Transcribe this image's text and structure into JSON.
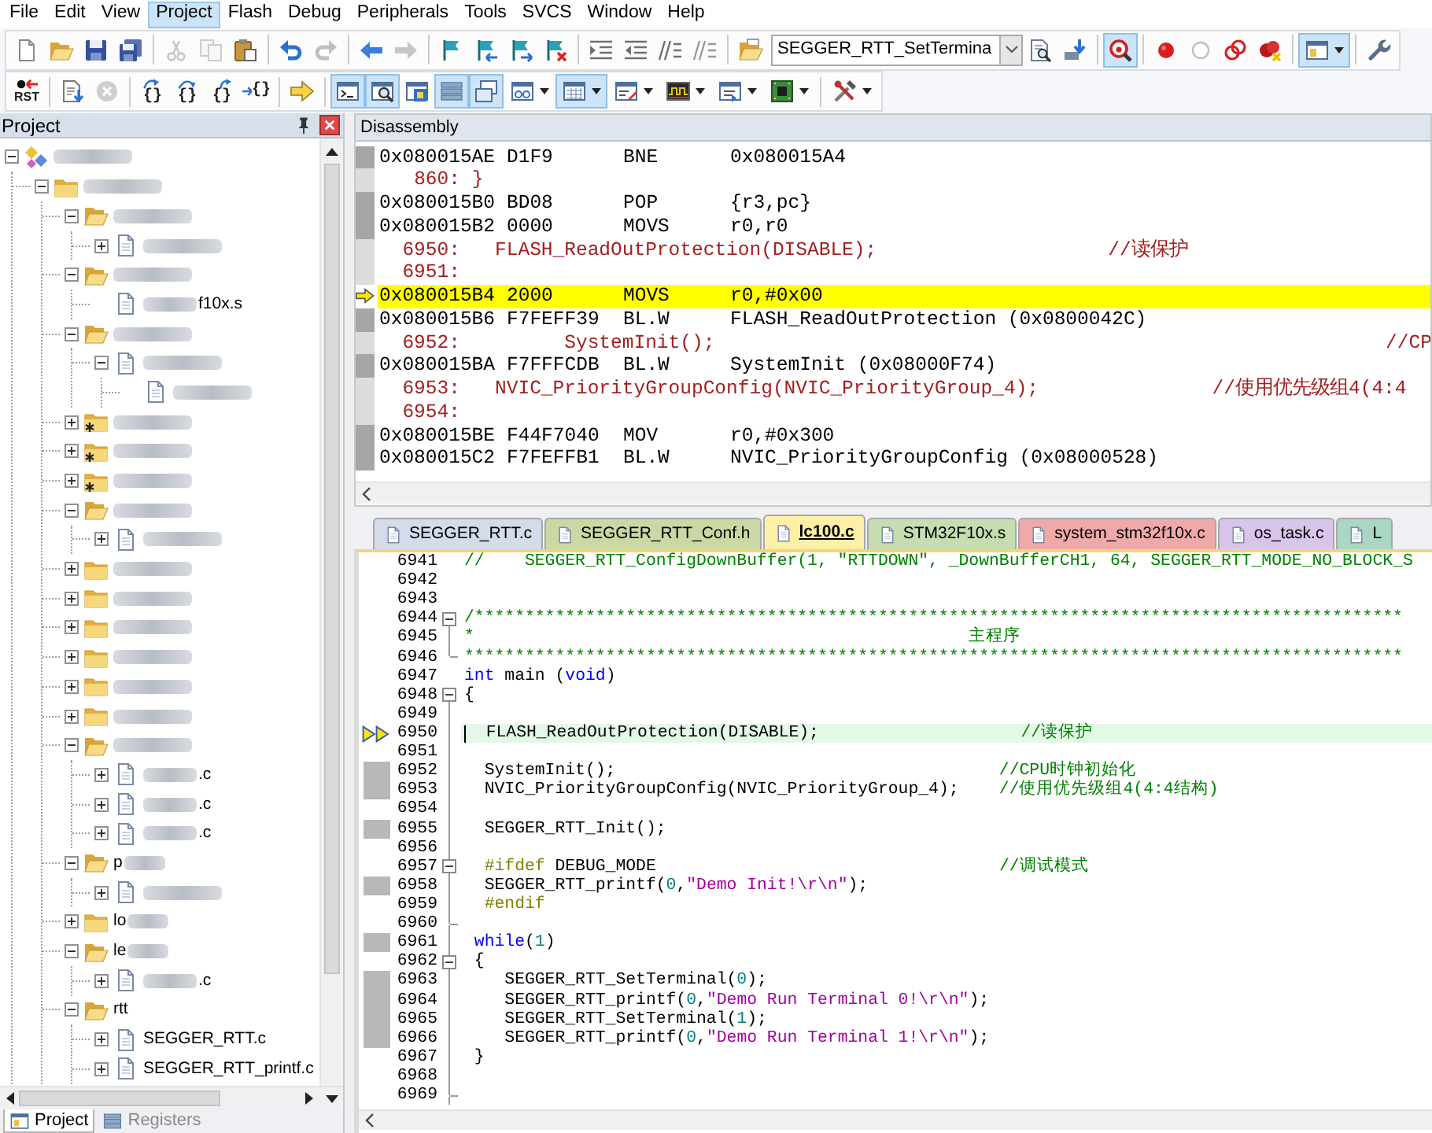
{
  "menu_bar": [
    {
      "label": "File",
      "selected": false
    },
    {
      "label": "Edit",
      "selected": false
    },
    {
      "label": "View",
      "selected": false
    },
    {
      "label": "Project",
      "selected": true
    },
    {
      "label": "Flash",
      "selected": false
    },
    {
      "label": "Debug",
      "selected": false
    },
    {
      "label": "Peripherals",
      "selected": false
    },
    {
      "label": "Tools",
      "selected": false
    },
    {
      "label": "SVCS",
      "selected": false
    },
    {
      "label": "Window",
      "selected": false
    },
    {
      "label": "Help",
      "selected": false
    }
  ],
  "toolbar_1": {
    "buttons": [
      {
        "pressed": false,
        "disabled": false
      },
      {
        "pressed": false,
        "disabled": false
      },
      {
        "pressed": false,
        "disabled": false
      },
      {
        "pressed": false,
        "disabled": false
      },
      {
        "pressed": false,
        "disabled": true
      },
      {
        "pressed": false,
        "disabled": true
      },
      {
        "pressed": false,
        "disabled": false
      },
      {
        "pressed": false,
        "disabled": false
      },
      {
        "pressed": false,
        "disabled": true
      },
      {
        "pressed": false,
        "disabled": false
      },
      {
        "pressed": false,
        "disabled": true
      },
      {
        "pressed": false,
        "disabled": false
      },
      {
        "pressed": false,
        "disabled": false
      },
      {
        "pressed": false,
        "disabled": false
      },
      {
        "pressed": false,
        "disabled": false
      },
      {
        "pressed": false,
        "disabled": false
      },
      {
        "pressed": false,
        "disabled": false
      },
      {
        "pressed": false,
        "disabled": false
      },
      {
        "pressed": false,
        "disabled": false
      },
      {
        "pressed": false,
        "disabled": false
      },
      {
        "pressed": false,
        "disabled": false
      },
      {
        "pressed": false,
        "disabled": false
      },
      {
        "pressed": true,
        "disabled": false
      },
      {
        "pressed": false,
        "disabled": false
      },
      {
        "pressed": false,
        "disabled": false
      },
      {
        "pressed": false,
        "disabled": false
      },
      {
        "pressed": false,
        "disabled": false
      },
      {
        "pressed": true,
        "disabled": false
      },
      {
        "pressed": false,
        "disabled": false
      }
    ],
    "function_combo": {
      "value": "SEGGER_RTT_SetTermina"
    }
  },
  "toolbar_2": {
    "buttons": [
      {
        "label": "RST",
        "pressed": false,
        "disabled": false
      },
      {
        "pressed": false,
        "disabled": false
      },
      {
        "pressed": false,
        "disabled": true
      },
      {
        "label": "{}",
        "pressed": false,
        "disabled": false
      },
      {
        "label": "{}",
        "pressed": false,
        "disabled": false
      },
      {
        "label": "{}",
        "pressed": false,
        "disabled": false
      },
      {
        "label": "{}",
        "pressed": false,
        "disabled": false
      },
      {
        "pressed": false,
        "disabled": false
      },
      {
        "pressed": true,
        "disabled": false
      },
      {
        "pressed": true,
        "disabled": false
      },
      {
        "pressed": false,
        "disabled": false
      },
      {
        "pressed": true,
        "disabled": false
      },
      {
        "pressed": true,
        "disabled": false
      },
      {
        "pressed": false,
        "disabled": false
      },
      {
        "pressed": true,
        "disabled": false
      },
      {
        "pressed": false,
        "disabled": false
      },
      {
        "pressed": false,
        "disabled": false
      },
      {
        "pressed": false,
        "disabled": false
      },
      {
        "pressed": false,
        "disabled": false
      },
      {
        "pressed": false,
        "disabled": false
      }
    ]
  },
  "project_panel": {
    "title": "Project",
    "tree": [
      {
        "kind": "project",
        "blur_before": true,
        "blur_after": false,
        "expanded": true,
        "children": [
          {
            "kind": "target",
            "blur_before": true,
            "blur_after": false,
            "expanded": true,
            "children": [
              {
                "kind": "group",
                "starred": false,
                "blur_before": true,
                "blur_after": false,
                "expanded": true,
                "children": [
                  {
                    "kind": "file",
                    "blur_before": true,
                    "blur_after": false,
                    "expanded": false
                  }
                ]
              },
              {
                "kind": "group",
                "starred": false,
                "blur_before": true,
                "blur_after": false,
                "expanded": true,
                "children": [
                  {
                    "kind": "file",
                    "label": "f10x.s",
                    "blur_before": true,
                    "blur_after": false
                  }
                ]
              },
              {
                "kind": "group",
                "starred": false,
                "blur_before": true,
                "blur_after": false,
                "expanded": true,
                "children": [
                  {
                    "kind": "file",
                    "blur_before": true,
                    "blur_after": false,
                    "expanded": true,
                    "children": [
                      {
                        "kind": "file",
                        "blur_before": true,
                        "blur_after": false
                      }
                    ]
                  }
                ]
              },
              {
                "kind": "group",
                "starred": true,
                "blur_before": true,
                "blur_after": false,
                "expanded": false
              },
              {
                "kind": "group",
                "starred": true,
                "blur_before": true,
                "blur_after": false,
                "expanded": false
              },
              {
                "kind": "group",
                "starred": true,
                "blur_before": true,
                "blur_after": false,
                "expanded": false
              },
              {
                "kind": "group",
                "starred": false,
                "blur_before": true,
                "blur_after": false,
                "expanded": true,
                "children": [
                  {
                    "kind": "file",
                    "blur_before": true,
                    "blur_after": false,
                    "expanded": false
                  }
                ]
              },
              {
                "kind": "group",
                "starred": false,
                "blur_before": true,
                "blur_after": false,
                "expanded": false
              },
              {
                "kind": "group",
                "starred": false,
                "blur_before": true,
                "blur_after": false,
                "expanded": false
              },
              {
                "kind": "group",
                "starred": false,
                "blur_before": true,
                "blur_after": false,
                "expanded": false
              },
              {
                "kind": "group",
                "starred": false,
                "blur_before": true,
                "blur_after": false,
                "expanded": false
              },
              {
                "kind": "group",
                "starred": false,
                "blur_before": true,
                "blur_after": false,
                "expanded": false
              },
              {
                "kind": "group",
                "starred": false,
                "blur_before": true,
                "blur_after": false,
                "expanded": false
              },
              {
                "kind": "group",
                "starred": false,
                "blur_before": true,
                "blur_after": false,
                "expanded": true,
                "children": [
                  {
                    "kind": "file",
                    "label": ".c",
                    "blur_before": true,
                    "blur_after": false,
                    "expanded": false
                  },
                  {
                    "kind": "file",
                    "label": ".c",
                    "blur_before": true,
                    "blur_after": false,
                    "expanded": false
                  },
                  {
                    "kind": "file",
                    "label": ".c",
                    "blur_before": true,
                    "blur_after": false,
                    "expanded": false
                  }
                ]
              },
              {
                "kind": "group",
                "starred": false,
                "label": "p",
                "blur_before": false,
                "blur_after": true,
                "expanded": true,
                "children": [
                  {
                    "kind": "file",
                    "blur_before": true,
                    "blur_after": false,
                    "expanded": false
                  }
                ]
              },
              {
                "kind": "group",
                "starred": false,
                "label": "lo",
                "blur_before": false,
                "blur_after": true,
                "expanded": false
              },
              {
                "kind": "group",
                "starred": false,
                "label": "le",
                "blur_before": false,
                "blur_after": true,
                "expanded": true,
                "children": [
                  {
                    "kind": "file",
                    "label": ".c",
                    "blur_before": true,
                    "blur_after": false,
                    "expanded": false
                  }
                ]
              },
              {
                "kind": "group",
                "starred": false,
                "label": "rtt",
                "blur_before": false,
                "blur_after": false,
                "expanded": true,
                "children": [
                  {
                    "kind": "file",
                    "label": "SEGGER_RTT.c",
                    "blur_before": false,
                    "blur_after": false,
                    "expanded": false
                  },
                  {
                    "kind": "file",
                    "label": "SEGGER_RTT_printf.c",
                    "blur_before": false,
                    "blur_after": false,
                    "expanded": false
                  }
                ]
              }
            ]
          }
        ]
      }
    ],
    "tabs": [
      {
        "kind": "project",
        "label": "Project",
        "selected": true
      },
      {
        "kind": "registers",
        "label": "Registers",
        "selected": false
      }
    ]
  },
  "disassembly": {
    "title": "Disassembly",
    "lines": [
      {
        "kind": "asm",
        "address": "0x080015AE",
        "opcode": "D1F9",
        "mnemonic": "BNE",
        "operands": "0x080015A4",
        "current": false
      },
      {
        "kind": "source",
        "text": "   860: }",
        "current": false
      },
      {
        "kind": "asm",
        "address": "0x080015B0",
        "opcode": "BD08",
        "mnemonic": "POP",
        "operands": "{r3,pc}",
        "current": false
      },
      {
        "kind": "asm",
        "address": "0x080015B2",
        "opcode": "0000",
        "mnemonic": "MOVS",
        "operands": "r0,r0",
        "current": false
      },
      {
        "kind": "source",
        "text": "  6950:   FLASH_ReadOutProtection(DISABLE);                    //读保护",
        "current": false
      },
      {
        "kind": "source",
        "text": "  6951:",
        "current": false
      },
      {
        "kind": "asm",
        "address": "0x080015B4",
        "opcode": "2000",
        "mnemonic": "MOVS",
        "operands": "r0,#0x00",
        "current": true
      },
      {
        "kind": "asm",
        "address": "0x080015B6",
        "opcode": "F7FEFF39",
        "mnemonic": "BL.W",
        "operands": "FLASH_ReadOutProtection (0x0800042C)",
        "current": false
      },
      {
        "kind": "source",
        "text": "  6952:         SystemInit();                                                          //CP",
        "current": false
      },
      {
        "kind": "asm",
        "address": "0x080015BA",
        "opcode": "F7FFFCDB",
        "mnemonic": "BL.W",
        "operands": "SystemInit (0x08000F74)",
        "current": false
      },
      {
        "kind": "source",
        "text": "  6953:   NVIC_PriorityGroupConfig(NVIC_PriorityGroup_4);               //使用优先级组4(4:4",
        "current": false
      },
      {
        "kind": "source",
        "text": "  6954:",
        "current": false
      },
      {
        "kind": "asm",
        "address": "0x080015BE",
        "opcode": "F44F7040",
        "mnemonic": "MOV",
        "operands": "r0,#0x300",
        "current": false
      },
      {
        "kind": "asm",
        "address": "0x080015C2",
        "opcode": "F7FEFFB1",
        "mnemonic": "BL.W",
        "operands": "NVIC_PriorityGroupConfig (0x08000528)",
        "current": false
      }
    ]
  },
  "editor": {
    "tabs": [
      {
        "label": "SEGGER_RTT.c",
        "selected": false,
        "color": "#d4dbea"
      },
      {
        "label": "SEGGER_RTT_Conf.h",
        "selected": false,
        "color": "#cbd8a3"
      },
      {
        "label": "lc100.c",
        "selected": true,
        "color": "#fdf0a6"
      },
      {
        "label": "STM32F10x.s",
        "selected": false,
        "color": "#c5ddb0"
      },
      {
        "label": "system_stm32f10x.c",
        "selected": false,
        "color": "#f0a9a9"
      },
      {
        "label": "os_task.c",
        "selected": false,
        "color": "#d9c5ec"
      },
      {
        "label": "L",
        "selected": false,
        "color": "#a9d7c3"
      }
    ],
    "lines": [
      {
        "number": "6941",
        "current": false,
        "executed": false,
        "caret": false,
        "fold_start": false,
        "fold_end": false,
        "tokens": [
          {
            "kind": "comment",
            "text": "//    SEGGER_RTT_ConfigDownBuffer(1, \"RTTDOWN\", _DownBufferCH1, 64, SEGGER_RTT_MODE_NO_BLOCK_S"
          }
        ]
      },
      {
        "number": "6942",
        "current": false,
        "executed": false,
        "caret": false,
        "fold_start": false,
        "fold_end": false
      },
      {
        "number": "6943",
        "current": false,
        "executed": false,
        "caret": false,
        "fold_start": false,
        "fold_end": false
      },
      {
        "number": "6944",
        "current": false,
        "executed": false,
        "caret": false,
        "fold_start": true,
        "fold_end": false,
        "tokens": [
          {
            "kind": "comment",
            "text": "/********************************************************************************************"
          }
        ]
      },
      {
        "number": "6945",
        "current": false,
        "executed": false,
        "caret": false,
        "fold_start": false,
        "fold_end": false,
        "tokens": [
          {
            "kind": "comment",
            "text": "*                                                 主程序"
          }
        ]
      },
      {
        "number": "6946",
        "current": false,
        "executed": false,
        "caret": false,
        "fold_start": false,
        "fold_end": true,
        "tokens": [
          {
            "kind": "comment",
            "text": "*********************************************************************************************"
          }
        ]
      },
      {
        "number": "6947",
        "current": false,
        "executed": false,
        "caret": false,
        "fold_start": false,
        "fold_end": false,
        "tokens": [
          {
            "kind": "keyword",
            "text": "int"
          },
          {
            "kind": "plain",
            "text": " main ("
          },
          {
            "kind": "keyword",
            "text": "void"
          },
          {
            "kind": "plain",
            "text": ")"
          }
        ]
      },
      {
        "number": "6948",
        "current": false,
        "executed": false,
        "caret": false,
        "fold_start": true,
        "fold_end": false,
        "tokens": [
          {
            "kind": "plain",
            "text": "{"
          }
        ]
      },
      {
        "number": "6949",
        "current": false,
        "executed": false,
        "caret": false,
        "fold_start": false,
        "fold_end": false
      },
      {
        "number": "6950",
        "current": true,
        "executed": false,
        "caret": true,
        "fold_start": false,
        "fold_end": false,
        "tokens": [
          {
            "kind": "plain",
            "text": "  FLASH_ReadOutProtection(DISABLE);                    "
          },
          {
            "kind": "comment",
            "text": "//读保护"
          }
        ]
      },
      {
        "number": "6951",
        "current": false,
        "executed": false,
        "caret": false,
        "fold_start": false,
        "fold_end": false
      },
      {
        "number": "6952",
        "current": false,
        "executed": true,
        "caret": false,
        "fold_start": false,
        "fold_end": false,
        "tokens": [
          {
            "kind": "plain",
            "text": "  SystemInit();                                      "
          },
          {
            "kind": "comment",
            "text": "//CPU时钟初始化"
          }
        ]
      },
      {
        "number": "6953",
        "current": false,
        "executed": true,
        "caret": false,
        "fold_start": false,
        "fold_end": false,
        "tokens": [
          {
            "kind": "plain",
            "text": "  NVIC_PriorityGroupConfig(NVIC_PriorityGroup_4);    "
          },
          {
            "kind": "comment",
            "text": "//使用优先级组4(4:4结构)"
          }
        ]
      },
      {
        "number": "6954",
        "current": false,
        "executed": false,
        "caret": false,
        "fold_start": false,
        "fold_end": false
      },
      {
        "number": "6955",
        "current": false,
        "executed": true,
        "caret": false,
        "fold_start": false,
        "fold_end": false,
        "tokens": [
          {
            "kind": "plain",
            "text": "  SEGGER_RTT_Init();"
          }
        ]
      },
      {
        "number": "6956",
        "current": false,
        "executed": false,
        "caret": false,
        "fold_start": false,
        "fold_end": false
      },
      {
        "number": "6957",
        "current": false,
        "executed": false,
        "caret": false,
        "fold_start": true,
        "fold_end": false,
        "tokens": [
          {
            "kind": "preproc",
            "text": "  #ifdef"
          },
          {
            "kind": "plain",
            "text": " DEBUG_MODE                                  "
          },
          {
            "kind": "comment",
            "text": "//调试模式"
          }
        ]
      },
      {
        "number": "6958",
        "current": false,
        "executed": true,
        "caret": false,
        "fold_start": false,
        "fold_end": false,
        "tokens": [
          {
            "kind": "plain",
            "text": "  SEGGER_RTT_printf("
          },
          {
            "kind": "number",
            "text": "0"
          },
          {
            "kind": "plain",
            "text": ","
          },
          {
            "kind": "string",
            "text": "\"Demo Init!\\r\\n\""
          },
          {
            "kind": "plain",
            "text": ");"
          }
        ]
      },
      {
        "number": "6959",
        "current": false,
        "executed": false,
        "caret": false,
        "fold_start": false,
        "fold_end": false,
        "tokens": [
          {
            "kind": "preproc",
            "text": "  #endif"
          }
        ]
      },
      {
        "number": "6960",
        "current": false,
        "executed": false,
        "caret": false,
        "fold_start": false,
        "fold_end": true
      },
      {
        "number": "6961",
        "current": false,
        "executed": true,
        "caret": false,
        "fold_start": false,
        "fold_end": false,
        "tokens": [
          {
            "kind": "keyword",
            "text": " while"
          },
          {
            "kind": "plain",
            "text": "("
          },
          {
            "kind": "number",
            "text": "1"
          },
          {
            "kind": "plain",
            "text": ")"
          }
        ]
      },
      {
        "number": "6962",
        "current": false,
        "executed": false,
        "caret": false,
        "fold_start": true,
        "fold_end": false,
        "tokens": [
          {
            "kind": "plain",
            "text": " {"
          }
        ]
      },
      {
        "number": "6963",
        "current": false,
        "executed": true,
        "caret": false,
        "fold_start": false,
        "fold_end": false,
        "tokens": [
          {
            "kind": "plain",
            "text": "    SEGGER_RTT_SetTerminal("
          },
          {
            "kind": "number",
            "text": "0"
          },
          {
            "kind": "plain",
            "text": ");"
          }
        ]
      },
      {
        "number": "6964",
        "current": false,
        "executed": true,
        "caret": false,
        "fold_start": false,
        "fold_end": false,
        "tokens": [
          {
            "kind": "plain",
            "text": "    SEGGER_RTT_printf("
          },
          {
            "kind": "number",
            "text": "0"
          },
          {
            "kind": "plain",
            "text": ","
          },
          {
            "kind": "string",
            "text": "\"Demo Run Terminal 0!\\r\\n\""
          },
          {
            "kind": "plain",
            "text": ");"
          }
        ]
      },
      {
        "number": "6965",
        "current": false,
        "executed": true,
        "caret": false,
        "fold_start": false,
        "fold_end": false,
        "tokens": [
          {
            "kind": "plain",
            "text": "    SEGGER_RTT_SetTerminal("
          },
          {
            "kind": "number",
            "text": "1"
          },
          {
            "kind": "plain",
            "text": ");"
          }
        ]
      },
      {
        "number": "6966",
        "current": false,
        "executed": true,
        "caret": false,
        "fold_start": false,
        "fold_end": false,
        "tokens": [
          {
            "kind": "plain",
            "text": "    SEGGER_RTT_printf("
          },
          {
            "kind": "number",
            "text": "0"
          },
          {
            "kind": "plain",
            "text": ","
          },
          {
            "kind": "string",
            "text": "\"Demo Run Terminal 1!\\r\\n\""
          },
          {
            "kind": "plain",
            "text": ");"
          }
        ]
      },
      {
        "number": "6967",
        "current": false,
        "executed": false,
        "caret": false,
        "fold_start": false,
        "fold_end": false,
        "tokens": [
          {
            "kind": "plain",
            "text": " }"
          }
        ]
      },
      {
        "number": "6968",
        "current": false,
        "executed": false,
        "caret": false,
        "fold_start": false,
        "fold_end": false
      },
      {
        "number": "6969",
        "current": false,
        "executed": false,
        "caret": false,
        "fold_start": false,
        "fold_end": true
      }
    ]
  }
}
